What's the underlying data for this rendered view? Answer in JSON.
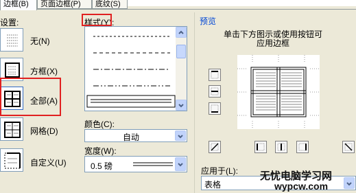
{
  "tabs": [
    {
      "label": "边框(B)",
      "active": true
    },
    {
      "label": "页面边框(P)",
      "active": false
    },
    {
      "label": "底纹(S)",
      "active": false
    }
  ],
  "setting": {
    "heading": "设置:",
    "items": [
      {
        "label": "无(N)",
        "icon": "none-border-icon"
      },
      {
        "label": "方框(X)",
        "icon": "box-border-icon"
      },
      {
        "label": "全部(A)",
        "icon": "all-border-icon",
        "selected": true
      },
      {
        "label": "网格(D)",
        "icon": "grid-border-icon"
      },
      {
        "label": "自定义(U)",
        "icon": "custom-border-icon"
      }
    ]
  },
  "style": {
    "label": "样式(Y):",
    "options": [
      "dashed-fine",
      "dashed-medium",
      "dash-dot",
      "dash-dot-dot",
      "double-line"
    ],
    "selected": "double-line"
  },
  "color": {
    "label": "颜色(C):",
    "value": "自动"
  },
  "width": {
    "label": "宽度(W):",
    "value": "0.5 磅"
  },
  "preview": {
    "heading": "预览",
    "hint_line1": "单击下方图示或使用按钮可",
    "hint_line2": "应用边框"
  },
  "apply_to": {
    "label": "应用于(L):",
    "value": "表格"
  },
  "watermark": {
    "line1": "无忧电脑学习网",
    "line2": "wypcw.com"
  },
  "colors": {
    "dialog_bg": "#ece9d8",
    "highlight_red": "#e02020",
    "border_blue": "#7f9db9"
  }
}
